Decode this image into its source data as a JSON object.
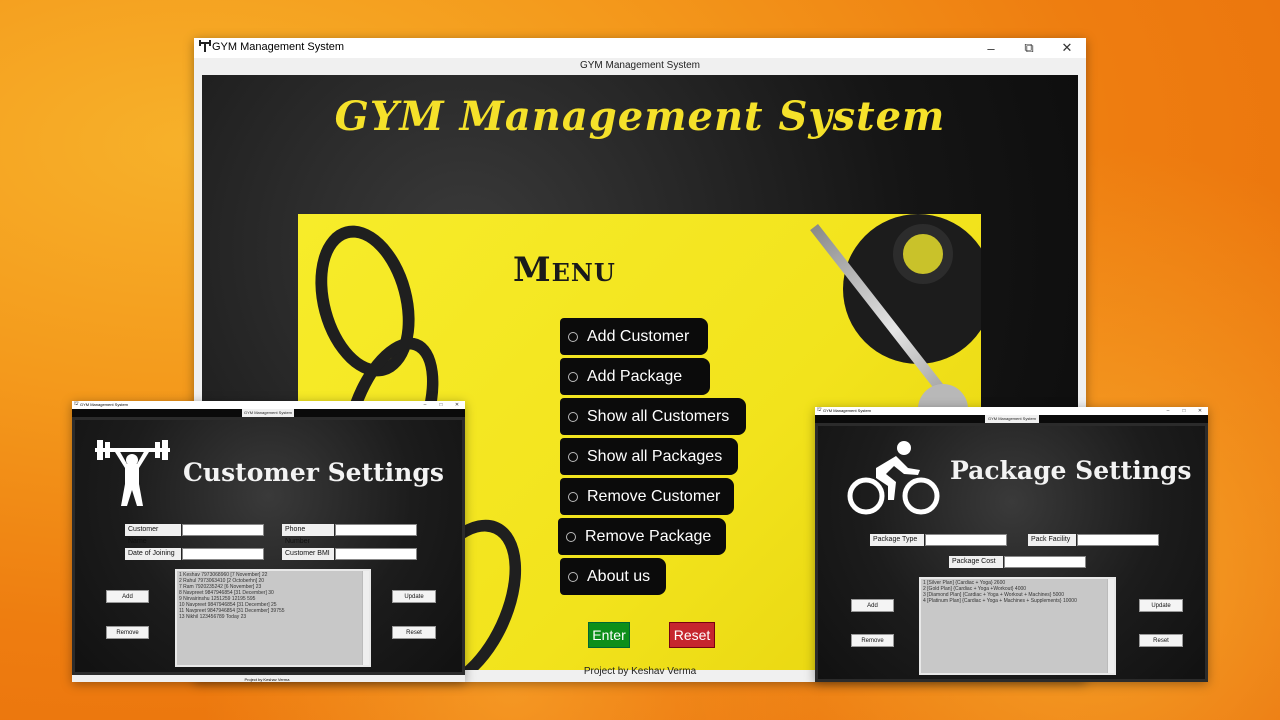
{
  "main_window": {
    "title": "GYM Management System",
    "caption": "GYM Management System",
    "heading": "GYM Management System",
    "menu_title": "Menu",
    "menu_items": [
      {
        "label": "Add Customer"
      },
      {
        "label": "Add Package"
      },
      {
        "label": "Show all Customers"
      },
      {
        "label": "Show all Packages"
      },
      {
        "label": "Remove Customer"
      },
      {
        "label": "Remove Package"
      },
      {
        "label": "About us"
      }
    ],
    "enter_label": "Enter",
    "reset_label": "Reset",
    "footer": "Project by Keshav Verma",
    "controls": {
      "minimize": "–",
      "maximize": "⧉",
      "close": "✕"
    }
  },
  "customer_window": {
    "title": "GYM Management System",
    "caption": "GYM Management System",
    "heading": "Customer Settings",
    "labels": {
      "customer_name": "Customer Name",
      "phone_number": "Phone Number",
      "date_of_joining": "Date of Joining",
      "customer_bmi": "Customer BMI"
    },
    "list_rows": [
      "1 Keshav 7973068960 [7 November] 22",
      "2 Rahul 7973063410 [2 Octoberhn] 20",
      "7 Ram 7920235242 [6 November] 23",
      "8 Navpreet 9847946854 [31 December] 30",
      "9 Nirvairinshu 1251259 12195 595",
      "10 Navpreet 9847946854 [31 December] 25",
      "11 Navpreet 9847946854 [31 December] 39755",
      "13 Nikhil 123456789 Today 23"
    ],
    "buttons": {
      "add": "Add",
      "remove": "Remove",
      "update": "Update",
      "reset": "Reset"
    },
    "footer": "Project by Keshav Verma"
  },
  "package_window": {
    "title": "GYM Management System",
    "caption": "GYM Management System",
    "heading": "Package Settings",
    "labels": {
      "package_type": "Package Type",
      "pack_facility": "Pack Facility",
      "package_cost": "Package Cost"
    },
    "list_rows": [
      "1 [Silver Plan] {Cardiac + Yoga} 2600",
      "2 [Gold Plan] {Cardiac + Yoga +Workout} 4000",
      "3 [Diamond Plan] {Cardiac + Yoga + Workout + Machines} 5000",
      "4 [Platinum Plan] {Cardiac + Yoga + Machines + Supplements} 10000"
    ],
    "buttons": {
      "add": "Add",
      "remove": "Remove",
      "update": "Update",
      "reset": "Reset"
    }
  },
  "colors": {
    "accent_yellow": "#f5e12a",
    "enter_green": "#0d8f1a",
    "reset_red": "#c6262e",
    "frame_dark": "#101010"
  },
  "icons": {
    "app": "dumbbell-icon",
    "weightlifter": "weightlifter-icon",
    "cyclist": "cyclist-icon"
  }
}
